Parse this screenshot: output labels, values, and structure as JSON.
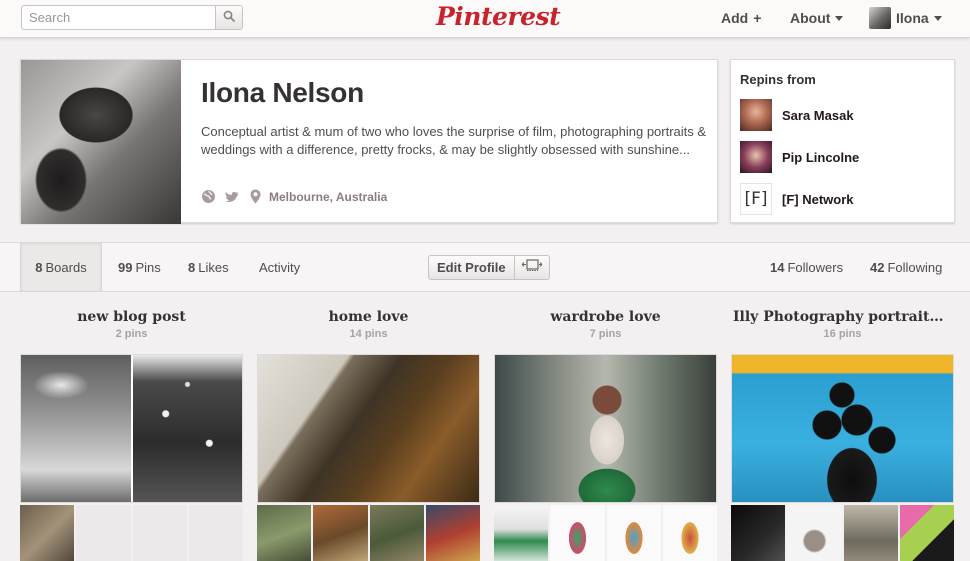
{
  "header": {
    "search_placeholder": "Search",
    "logo_text": "Pinterest",
    "nav": {
      "add_label": "Add",
      "about_label": "About",
      "user_label": "Ilona"
    }
  },
  "profile": {
    "name": "Ilona Nelson",
    "bio": "Conceptual artist & mum of two who loves the surprise of film, photographing portraits & weddings with a difference, pretty frocks, & may be slightly obsessed with sunshine...",
    "location": "Melbourne, Australia"
  },
  "repins": {
    "title": "Repins from",
    "items": [
      {
        "name": "Sara Masak"
      },
      {
        "name": "Pip Lincolne"
      },
      {
        "name": "[F] Network",
        "avatar_text": "[F]"
      }
    ]
  },
  "tabs": {
    "boards": {
      "count": "8",
      "label": "Boards"
    },
    "pins": {
      "count": "99",
      "label": "Pins"
    },
    "likes": {
      "count": "8",
      "label": "Likes"
    },
    "activity": {
      "label": "Activity"
    },
    "edit_profile": "Edit Profile",
    "followers": {
      "count": "14",
      "label": "Followers"
    },
    "following": {
      "count": "42",
      "label": "Following"
    }
  },
  "boards": [
    {
      "title": "new blog post",
      "count": "2 pins"
    },
    {
      "title": "home love",
      "count": "14 pins"
    },
    {
      "title": "wardrobe love",
      "count": "7 pins"
    },
    {
      "title": "Illy Photography portraitu...",
      "count": "16 pins"
    }
  ],
  "colors": {
    "brand_red": "#c8232c",
    "background": "#f2f0f0",
    "text": "#524d4d"
  }
}
